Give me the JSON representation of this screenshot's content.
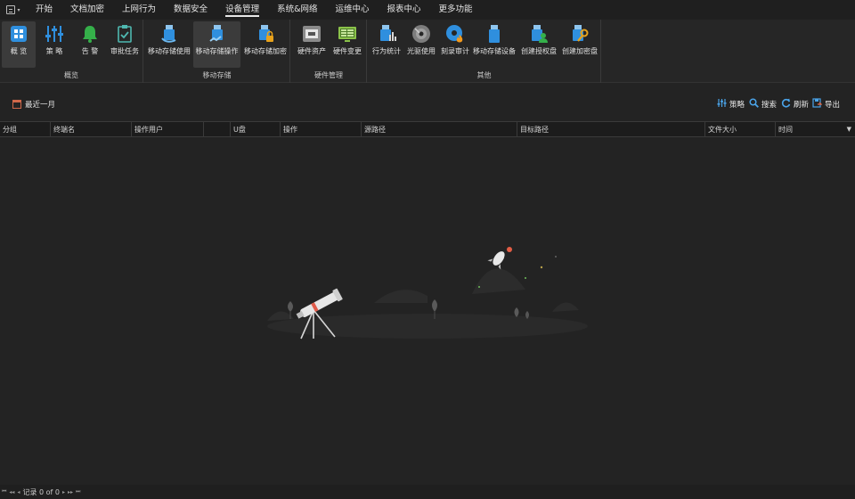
{
  "menu": {
    "tabs": [
      {
        "label": "开始"
      },
      {
        "label": "文档加密"
      },
      {
        "label": "上网行为"
      },
      {
        "label": "数据安全"
      },
      {
        "label": "设备管理"
      },
      {
        "label": "系统&网络"
      },
      {
        "label": "运维中心"
      },
      {
        "label": "报表中心"
      },
      {
        "label": "更多功能"
      }
    ],
    "active_tab": "设备管理"
  },
  "ribbon": {
    "groups": [
      {
        "label": "概览",
        "buttons": [
          {
            "label": "概 览",
            "icon": "overview-grid-icon",
            "selected": true
          },
          {
            "label": "策 略",
            "icon": "policy-sliders-icon"
          },
          {
            "label": "告 警",
            "icon": "alarm-bell-icon"
          },
          {
            "label": "审批任务",
            "icon": "approval-task-icon"
          }
        ]
      },
      {
        "label": "移动存储",
        "buttons": [
          {
            "label": "移动存储使用",
            "icon": "usb-usage-icon"
          },
          {
            "label": "移动存储操作",
            "icon": "usb-operation-icon",
            "selected": true
          },
          {
            "label": "移动存储加密",
            "icon": "usb-encrypt-icon"
          }
        ]
      },
      {
        "label": "硬件管理",
        "buttons": [
          {
            "label": "硬件资产",
            "icon": "hardware-asset-icon"
          },
          {
            "label": "硬件变更",
            "icon": "hardware-change-icon"
          }
        ]
      },
      {
        "label": "其他",
        "buttons": [
          {
            "label": "行为统计",
            "icon": "behavior-stats-icon"
          },
          {
            "label": "光驱使用",
            "icon": "cd-drive-icon"
          },
          {
            "label": "刻录审计",
            "icon": "burn-audit-icon"
          },
          {
            "label": "移动存储设备",
            "icon": "usb-device-icon"
          },
          {
            "label": "创建授权盘",
            "icon": "create-auth-disk-icon"
          },
          {
            "label": "创建加密盘",
            "icon": "create-encrypted-disk-icon"
          }
        ]
      }
    ]
  },
  "toolbar": {
    "range": "最近一月",
    "actions": [
      {
        "label": "策略",
        "icon": "policy-sliders-icon"
      },
      {
        "label": "搜索",
        "icon": "search-icon"
      },
      {
        "label": "刷新",
        "icon": "refresh-icon"
      },
      {
        "label": "导出",
        "icon": "export-icon"
      }
    ]
  },
  "table": {
    "columns": [
      {
        "label": "分组"
      },
      {
        "label": "终端名"
      },
      {
        "label": "操作用户"
      },
      {
        "label": ""
      },
      {
        "label": "U盘"
      },
      {
        "label": "操作"
      },
      {
        "label": "源路径"
      },
      {
        "label": "目标路径"
      },
      {
        "label": "文件大小"
      },
      {
        "label": "时间"
      }
    ],
    "rows": []
  },
  "status": {
    "record_text": "记录 0 of 0"
  },
  "colors": {
    "background": "#232323",
    "accent_blue": "#2f8fde",
    "alarm_green": "#35b04a",
    "key_orange": "#e8a21b"
  }
}
